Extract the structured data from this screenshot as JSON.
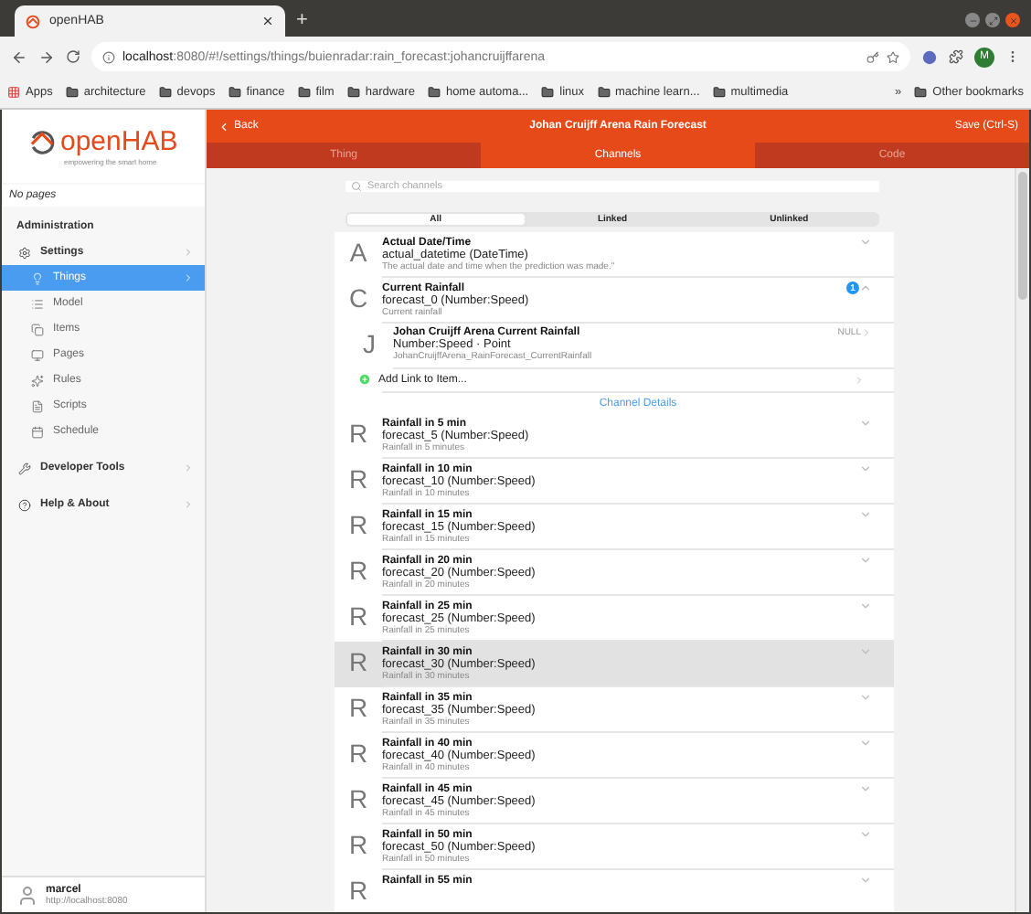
{
  "browser": {
    "tab_title": "openHAB",
    "new_tab": "+",
    "url_host": "localhost",
    "url_rest": ":8080/#!/settings/things/buienradar:rain_forecast:johancruijffarena",
    "avatar": "M",
    "bookmarks": [
      "Apps",
      "architecture",
      "devops",
      "finance",
      "film",
      "hardware",
      "home automa...",
      "linux",
      "machine learn...",
      "multimedia"
    ],
    "more_bookmarks": "»",
    "other_bookmarks": "Other bookmarks"
  },
  "sidebar": {
    "logo": "openHAB",
    "tagline": "empowering the smart home",
    "no_pages": "No pages",
    "section": "Administration",
    "items": [
      {
        "label": "Settings",
        "selected": false,
        "children": [
          {
            "label": "Things",
            "selected": true
          },
          {
            "label": "Model",
            "selected": false
          },
          {
            "label": "Items",
            "selected": false
          },
          {
            "label": "Pages",
            "selected": false
          },
          {
            "label": "Rules",
            "selected": false
          },
          {
            "label": "Scripts",
            "selected": false
          },
          {
            "label": "Schedule",
            "selected": false
          }
        ]
      },
      {
        "label": "Developer Tools",
        "selected": false
      },
      {
        "label": "Help & About",
        "selected": false
      }
    ],
    "user": {
      "name": "marcel",
      "server": "http://localhost:8080"
    }
  },
  "header": {
    "back": "Back",
    "title": "Johan Cruijff Arena Rain Forecast",
    "save": "Save (Ctrl-S)"
  },
  "tabs": [
    {
      "label": "Thing",
      "selected": false
    },
    {
      "label": "Channels",
      "selected": true
    },
    {
      "label": "Code",
      "selected": false
    }
  ],
  "search": {
    "placeholder": "Search channels"
  },
  "filters": [
    {
      "label": "All",
      "selected": true
    },
    {
      "label": "Linked",
      "selected": false
    },
    {
      "label": "Unlinked",
      "selected": false
    }
  ],
  "channels": [
    {
      "letter": "A",
      "title": "Actual Date/Time",
      "id": "actual_datetime (DateTime)",
      "description": "The actual date and time when the prediction was made.\"",
      "expanded": false,
      "highlighted": false
    },
    {
      "letter": "C",
      "title": "Current Rainfall",
      "id": "forecast_0 (Number:Speed)",
      "description": "Current rainfall",
      "expanded": true,
      "highlighted": false,
      "badge": "1",
      "links": [
        {
          "letter": "J",
          "title": "Johan Cruijff Arena Current Rainfall",
          "type": "Number:Speed · Point",
          "item": "JohanCruijffArena_RainForecast_CurrentRainfall",
          "state": "NULL"
        }
      ],
      "add_link": "Add Link to Item...",
      "details": "Channel Details"
    },
    {
      "letter": "R",
      "title": "Rainfall in 5 min",
      "id": "forecast_5 (Number:Speed)",
      "description": "Rainfall in 5 minutes",
      "expanded": false,
      "highlighted": false
    },
    {
      "letter": "R",
      "title": "Rainfall in 10 min",
      "id": "forecast_10 (Number:Speed)",
      "description": "Rainfall in 10 minutes",
      "expanded": false,
      "highlighted": false
    },
    {
      "letter": "R",
      "title": "Rainfall in 15 min",
      "id": "forecast_15 (Number:Speed)",
      "description": "Rainfall in 15 minutes",
      "expanded": false,
      "highlighted": false
    },
    {
      "letter": "R",
      "title": "Rainfall in 20 min",
      "id": "forecast_20 (Number:Speed)",
      "description": "Rainfall in 20 minutes",
      "expanded": false,
      "highlighted": false
    },
    {
      "letter": "R",
      "title": "Rainfall in 25 min",
      "id": "forecast_25 (Number:Speed)",
      "description": "Rainfall in 25 minutes",
      "expanded": false,
      "highlighted": false
    },
    {
      "letter": "R",
      "title": "Rainfall in 30 min",
      "id": "forecast_30 (Number:Speed)",
      "description": "Rainfall in 30 minutes",
      "expanded": false,
      "highlighted": true
    },
    {
      "letter": "R",
      "title": "Rainfall in 35 min",
      "id": "forecast_35 (Number:Speed)",
      "description": "Rainfall in 35 minutes",
      "expanded": false,
      "highlighted": false
    },
    {
      "letter": "R",
      "title": "Rainfall in 40 min",
      "id": "forecast_40 (Number:Speed)",
      "description": "Rainfall in 40 minutes",
      "expanded": false,
      "highlighted": false
    },
    {
      "letter": "R",
      "title": "Rainfall in 45 min",
      "id": "forecast_45 (Number:Speed)",
      "description": "Rainfall in 45 minutes",
      "expanded": false,
      "highlighted": false
    },
    {
      "letter": "R",
      "title": "Rainfall in 50 min",
      "id": "forecast_50 (Number:Speed)",
      "description": "Rainfall in 50 minutes",
      "expanded": false,
      "highlighted": false
    },
    {
      "letter": "R",
      "title": "Rainfall in 55 min",
      "expanded": false,
      "highlighted": false
    }
  ]
}
